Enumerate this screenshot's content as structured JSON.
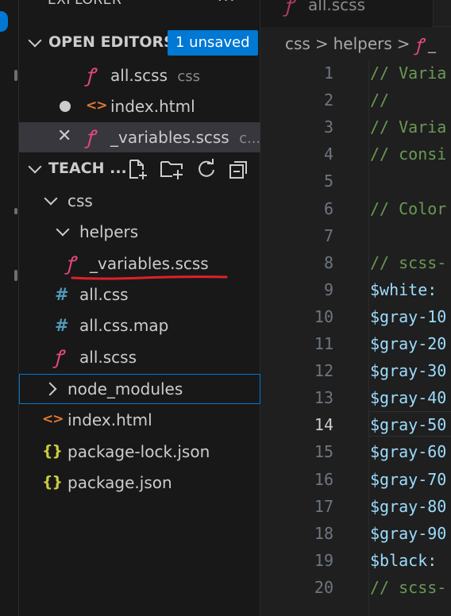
{
  "explorer": {
    "header": "EXPLORER",
    "more_icon": "ellipsis-icon"
  },
  "open_editors": {
    "title": "OPEN EDITORS",
    "badge": "1 unsaved",
    "items": [
      {
        "name": "all.scss",
        "folder": "css",
        "icon": "sass-icon"
      },
      {
        "name": "index.html",
        "icon": "html-icon",
        "unsaved": true
      },
      {
        "name": "_variables.scss",
        "folder": "c...",
        "icon": "sass-icon",
        "active": true
      }
    ]
  },
  "workspace": {
    "title": "TEACH ...",
    "toolbar_icons": [
      "new-file-icon",
      "new-folder-icon",
      "refresh-icon",
      "collapse-all-icon"
    ],
    "tree": [
      {
        "label": "css",
        "type": "folder",
        "expanded": true
      },
      {
        "label": "helpers",
        "type": "folder",
        "expanded": true
      },
      {
        "label": "_variables.scss",
        "type": "file",
        "icon": "sass-icon"
      },
      {
        "label": "all.css",
        "type": "file",
        "icon": "css-hash-icon"
      },
      {
        "label": "all.css.map",
        "type": "file",
        "icon": "css-hash-icon"
      },
      {
        "label": "all.scss",
        "type": "file",
        "icon": "sass-icon"
      },
      {
        "label": "node_modules",
        "type": "folder",
        "expanded": false
      },
      {
        "label": "index.html",
        "type": "file",
        "icon": "html-icon"
      },
      {
        "label": "package-lock.json",
        "type": "file",
        "icon": "json-icon"
      },
      {
        "label": "package.json",
        "type": "file",
        "icon": "json-icon"
      }
    ]
  },
  "glyphs": {
    "sass": "ꝭ",
    "html": "<>",
    "css": "#",
    "json": "{}",
    "close": "✕",
    "sep": ">"
  },
  "tab": {
    "label": "all.scss"
  },
  "breadcrumb": {
    "items": [
      "css",
      "helpers",
      "_"
    ]
  },
  "editor": {
    "current_line": 14,
    "lines": [
      {
        "n": "1",
        "text": "// Varia",
        "kind": "comment"
      },
      {
        "n": "2",
        "text": "//",
        "kind": "comment"
      },
      {
        "n": "3",
        "text": "// Varia",
        "kind": "comment"
      },
      {
        "n": "4",
        "text": "// consi",
        "kind": "comment"
      },
      {
        "n": "5",
        "text": "",
        "kind": "comment"
      },
      {
        "n": "6",
        "text": "// Color",
        "kind": "comment"
      },
      {
        "n": "7",
        "text": "",
        "kind": "comment"
      },
      {
        "n": "8",
        "text": "// scss-",
        "kind": "comment"
      },
      {
        "n": "9",
        "text": "$white:",
        "kind": "var"
      },
      {
        "n": "10",
        "text": "$gray-10",
        "kind": "var"
      },
      {
        "n": "11",
        "text": "$gray-20",
        "kind": "var"
      },
      {
        "n": "12",
        "text": "$gray-30",
        "kind": "var"
      },
      {
        "n": "13",
        "text": "$gray-40",
        "kind": "var"
      },
      {
        "n": "14",
        "text": "$gray-50",
        "kind": "var"
      },
      {
        "n": "15",
        "text": "$gray-60",
        "kind": "var"
      },
      {
        "n": "16",
        "text": "$gray-70",
        "kind": "var"
      },
      {
        "n": "17",
        "text": "$gray-80",
        "kind": "var"
      },
      {
        "n": "18",
        "text": "$gray-90",
        "kind": "var"
      },
      {
        "n": "19",
        "text": "$black:",
        "kind": "var"
      },
      {
        "n": "20",
        "text": "// scss-",
        "kind": "comment"
      }
    ]
  },
  "colors": {
    "accent": "#0078d4",
    "sass": "#e4487c",
    "html": "#e37933",
    "css": "#519aba",
    "json": "#cbcb41",
    "comment": "#6a9955",
    "variable": "#9cdcfe",
    "annotation_underline": "#e0202a"
  }
}
